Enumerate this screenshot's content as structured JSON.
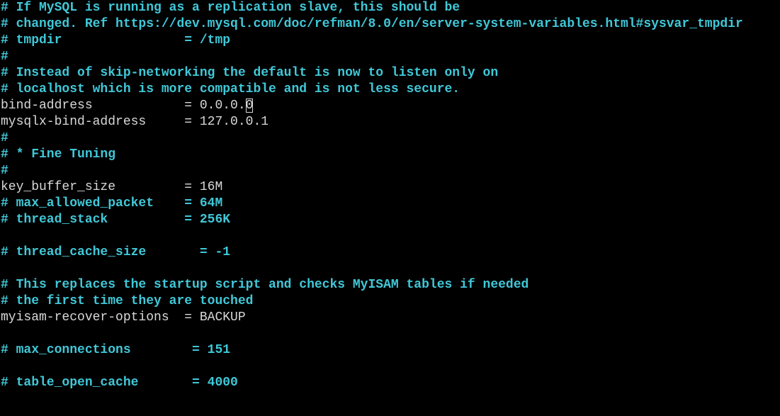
{
  "colors": {
    "background": "#000000",
    "comment": "#40c8d8",
    "setting": "#d8d8d8"
  },
  "lines": [
    {
      "kind": "comment",
      "text": "# If MySQL is running as a replication slave, this should be"
    },
    {
      "kind": "comment",
      "text": "# changed. Ref https://dev.mysql.com/doc/refman/8.0/en/server-system-variables.html#sysvar_tmpdir"
    },
    {
      "kind": "comment",
      "text": "# tmpdir                = /tmp"
    },
    {
      "kind": "comment",
      "text": "#"
    },
    {
      "kind": "comment",
      "text": "# Instead of skip-networking the default is now to listen only on"
    },
    {
      "kind": "comment",
      "text": "# localhost which is more compatible and is not less secure."
    },
    {
      "kind": "setting",
      "text": "bind-address            = 0.0.0.",
      "cursor_char": "0"
    },
    {
      "kind": "setting",
      "text": "mysqlx-bind-address     = 127.0.0.1"
    },
    {
      "kind": "comment",
      "text": "#"
    },
    {
      "kind": "comment",
      "text": "# * Fine Tuning"
    },
    {
      "kind": "comment",
      "text": "#"
    },
    {
      "kind": "setting",
      "text": "key_buffer_size         = 16M"
    },
    {
      "kind": "comment",
      "text": "# max_allowed_packet    = 64M"
    },
    {
      "kind": "comment",
      "text": "# thread_stack          = 256K"
    },
    {
      "kind": "blank",
      "text": ""
    },
    {
      "kind": "comment",
      "text": "# thread_cache_size       = -1"
    },
    {
      "kind": "blank",
      "text": ""
    },
    {
      "kind": "comment",
      "text": "# This replaces the startup script and checks MyISAM tables if needed"
    },
    {
      "kind": "comment",
      "text": "# the first time they are touched"
    },
    {
      "kind": "setting",
      "text": "myisam-recover-options  = BACKUP"
    },
    {
      "kind": "blank",
      "text": ""
    },
    {
      "kind": "comment",
      "text": "# max_connections        = 151"
    },
    {
      "kind": "blank",
      "text": ""
    },
    {
      "kind": "comment",
      "text": "# table_open_cache       = 4000"
    }
  ]
}
